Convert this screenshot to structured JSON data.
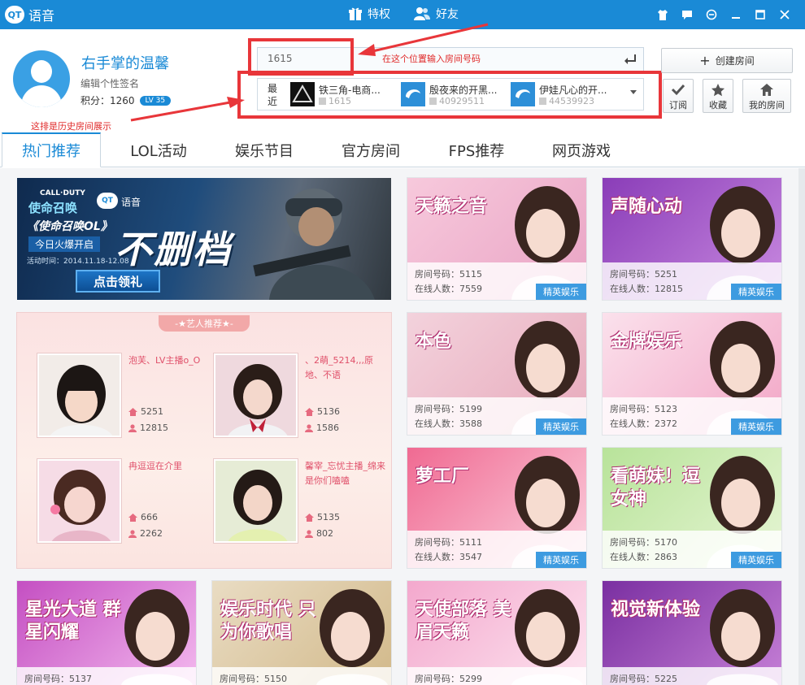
{
  "app": {
    "logo_badge": "QT",
    "logo_text": "语音"
  },
  "titlebar": {
    "nav_privilege": "特权",
    "nav_friends": "好友"
  },
  "profile": {
    "username": "右手掌的温馨",
    "signature": "编辑个性签名",
    "points": "积分：1260",
    "level": "LV 35"
  },
  "search": {
    "value": "1615",
    "hint": "在这个位置输入房间号码"
  },
  "recent": {
    "label": "最近",
    "hint": "这排是历史房间展示",
    "items": [
      {
        "name": "铁三角-电商...",
        "id": "1615"
      },
      {
        "name": "殷夜来的开黑...",
        "id": "40929511"
      },
      {
        "name": "伊娃凡心的开...",
        "id": "44539923"
      }
    ]
  },
  "actions": {
    "create_room": "创建房间",
    "subscribe": "订阅",
    "favorite": "收藏",
    "my_rooms": "我的房间"
  },
  "tabs": [
    "热门推荐",
    "LOL活动",
    "娱乐节目",
    "官方房间",
    "FPS推荐",
    "网页游戏"
  ],
  "banner": {
    "cod_en": "CALL·DUTY",
    "cod_cn": "使命召唤",
    "qt_logo": "QT",
    "qt_name": "语音",
    "title": "《使命召唤OL》",
    "subtitle": "今日火爆开启",
    "date": "活动时间：2014.11.18-12.08",
    "big": "不删档",
    "button": "点击领礼"
  },
  "artists": {
    "title": "-★艺人推荐★-",
    "items": [
      {
        "name": "泡芙、LV主播o_O",
        "room": "5251",
        "online": "12815"
      },
      {
        "name": "、2萌_5214,,,原地、不语",
        "room": "5136",
        "online": "1586"
      },
      {
        "name": "冉逗逗在介里",
        "room": "666",
        "online": "2262"
      },
      {
        "name": "馨宰_忘忧主播_绵来是你们嗑嗑",
        "room": "5135",
        "online": "802"
      }
    ]
  },
  "rooms": [
    {
      "img_text": "天籁之音",
      "room": "房间号码：5115",
      "online": "在线人数：7559",
      "tag": "精英娱乐",
      "color1": "#f7c9dc",
      "color2": "#e9a3c4"
    },
    {
      "img_text": "声随心动",
      "room": "房间号码：5251",
      "online": "在线人数：12815",
      "tag": "精英娱乐",
      "color1": "#8a3db8",
      "color2": "#c98ae0"
    },
    {
      "img_text": "本色",
      "room": "房间号码：5199",
      "online": "在线人数：3588",
      "tag": "精英娱乐",
      "color1": "#f3d2dc",
      "color2": "#e7a9bb"
    },
    {
      "img_text": "金牌娱乐",
      "room": "房间号码：5123",
      "online": "在线人数：2372",
      "tag": "精英娱乐",
      "color1": "#fbe1ec",
      "color2": "#f2a6c6"
    },
    {
      "img_text": "萝工厂",
      "room": "房间号码：5111",
      "online": "在线人数：3547",
      "tag": "精英娱乐",
      "color1": "#f06a92",
      "color2": "#fbd1df"
    },
    {
      "img_text": "看萌妹！逗女神",
      "room": "房间号码：5170",
      "online": "在线人数：2863",
      "tag": "精英娱乐",
      "color1": "#b8e39a",
      "color2": "#e6f5d4"
    },
    {
      "img_text": "星光大道 群星闪耀",
      "room": "房间号码：5137",
      "color1": "#c44fc2",
      "color2": "#f3b8ee"
    },
    {
      "img_text": "娱乐时代 只为你歌唱",
      "room": "房间号码：5150",
      "color1": "#e9dcc3",
      "color2": "#d2b98a"
    },
    {
      "img_text": "天使部落 美眉天籁",
      "room": "房间号码：5299",
      "color1": "#f3a8cd",
      "color2": "#fde3ef"
    },
    {
      "img_text": "视觉新体验",
      "room": "房间号码：5225",
      "color1": "#7a2fa1",
      "color2": "#c57fd6"
    }
  ],
  "colors": {
    "accent": "#1a8ad6",
    "highlight": "#e8363a",
    "tag_blue": "#3d9be0",
    "artist_name": "#e0506a"
  }
}
